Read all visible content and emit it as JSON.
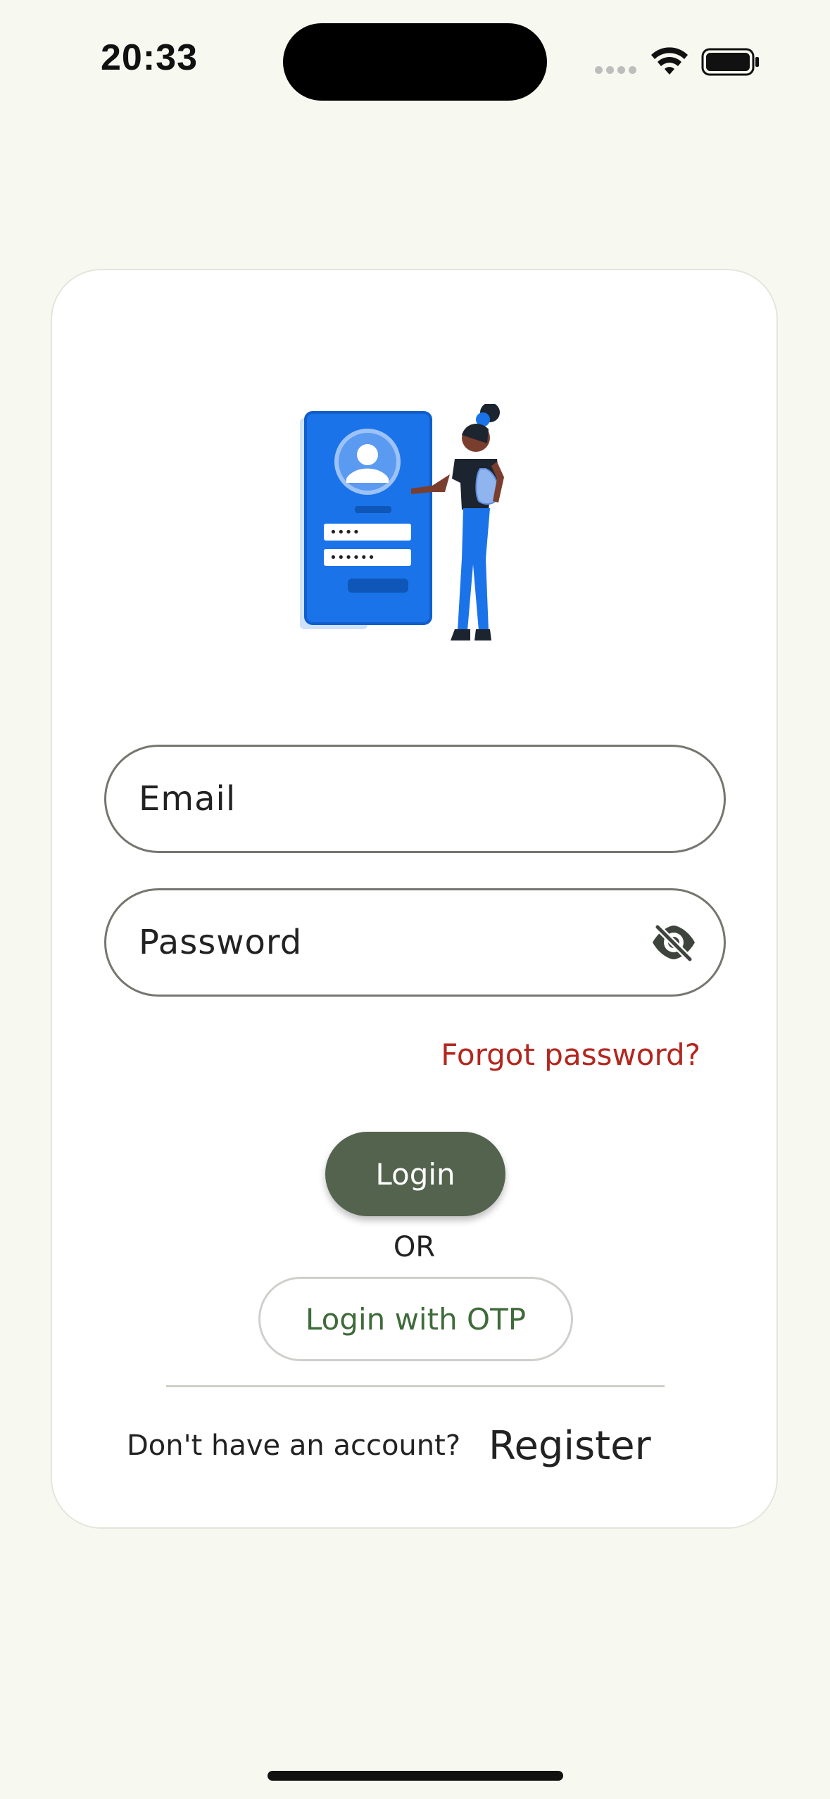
{
  "status_bar": {
    "time": "20:33",
    "icons": [
      "cellular-signal-icon",
      "wifi-icon",
      "battery-icon"
    ]
  },
  "login_card": {
    "illustration": "login-illustration",
    "email_field": {
      "placeholder": "Email"
    },
    "password_field": {
      "placeholder": "Password",
      "visibility_icon": "eye-off-icon"
    },
    "forgot_password_label": "Forgot password?",
    "login_button_label": "Login",
    "or_label": "OR",
    "otp_button_label": "Login with OTP",
    "register_prompt": "Don't have an account?",
    "register_link_label": "Register"
  },
  "colors": {
    "background": "#f7f9f1",
    "card": "#ffffff",
    "primary_button": "#53634d",
    "forgot_link": "#b3261e",
    "otp_text": "#3f6b3a",
    "illustration_blue": "#1a73e8"
  }
}
